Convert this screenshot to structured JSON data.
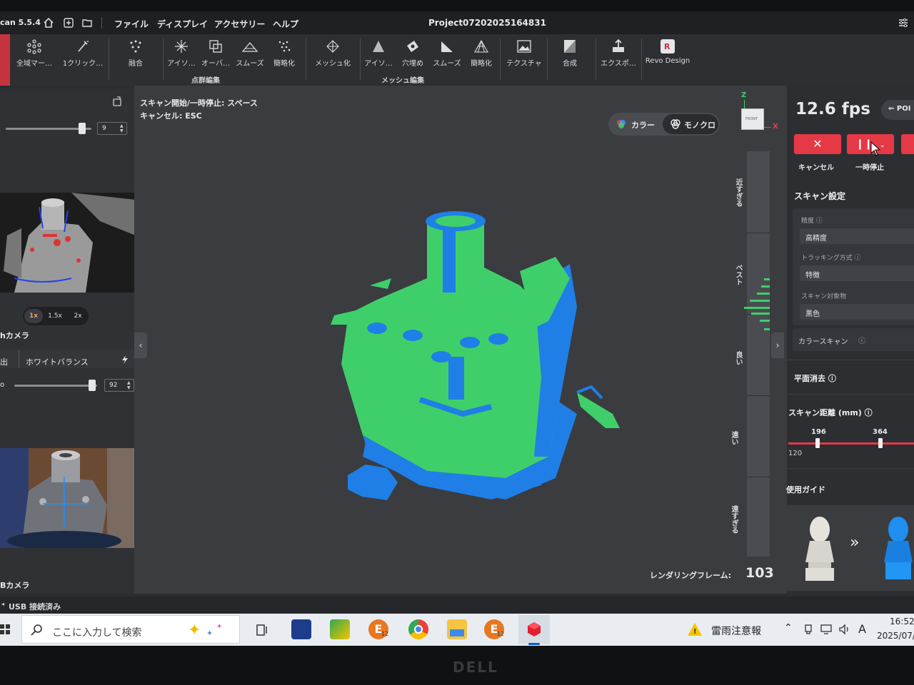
{
  "app": {
    "title_fragment": "can 5.5.4",
    "project": "Project07202025164831",
    "menu": [
      "ファイル",
      "ディスプレイ",
      "アクセサリー",
      "ヘルプ"
    ]
  },
  "ribbon": {
    "tools": [
      {
        "label": "全域マー…",
        "icon": "global-marker-icon"
      },
      {
        "label": "1クリック…",
        "icon": "one-click-icon"
      },
      {
        "label": "融合",
        "icon": "fuse-icon"
      },
      {
        "label": "アイソ…",
        "icon": "isolate-icon"
      },
      {
        "label": "オーバ…",
        "icon": "overlap-icon"
      },
      {
        "label": "スムーズ",
        "icon": "smooth-icon"
      },
      {
        "label": "簡略化",
        "icon": "simplify-icon"
      },
      {
        "label": "メッシュ化",
        "icon": "mesh-icon"
      },
      {
        "label": "アイソ…",
        "icon": "isolate-mesh-icon"
      },
      {
        "label": "穴埋め",
        "icon": "fill-hole-icon"
      },
      {
        "label": "スムーズ",
        "icon": "smooth-mesh-icon"
      },
      {
        "label": "簡略化",
        "icon": "simplify-mesh-icon"
      },
      {
        "label": "テクスチャ",
        "icon": "texture-icon"
      },
      {
        "label": "合成",
        "icon": "merge-icon"
      },
      {
        "label": "エクスポ…",
        "icon": "export-icon"
      },
      {
        "label": "Revo Design",
        "icon": "revo-design-icon"
      }
    ],
    "groups": {
      "point_cloud": "点群編集",
      "mesh": "メッシュ編集"
    }
  },
  "left": {
    "slider1_value": "9",
    "zoom_options": [
      "1x",
      "1.5x",
      "2x"
    ],
    "zoom_selected": "1x",
    "camera1_label": "hカメラ",
    "tab_exposure": "出",
    "tab_white_balance": "ホワイトバランス",
    "slider2_value": "92",
    "slider2_prefix": "o",
    "camera2_label": "Bカメラ"
  },
  "viewport": {
    "hint_scan": "スキャン開始/一時停止: スペース",
    "hint_cancel": "キャンセル: ESC",
    "mode_color": "カラー",
    "mode_mono": "モノクロ",
    "axis_z": "Z",
    "axis_x": "X",
    "cube_face": "FRONT",
    "distance_labels": [
      "近すぎる",
      "ベスト",
      "良い",
      "遠い",
      "遠すぎる"
    ],
    "render_label": "レンダリングフレーム:",
    "render_value": "103"
  },
  "right": {
    "fps": "12.6 fps",
    "po_label": "POI",
    "cancel_label": "キャンセル",
    "pause_label": "一時停止",
    "scan_settings": "スキャン設定",
    "precision_label": "精度",
    "precision_value": "高精度",
    "tracking_label": "トラッキング方式",
    "tracking_value": "特徴",
    "target_label": "スキャン対象物",
    "target_value": "黒色",
    "color_scan": "カラースキャン",
    "plane_removal": "平面消去",
    "scan_distance": "スキャン距離 (mm)",
    "dist_low": "196",
    "dist_high": "364",
    "dist_min": "120",
    "usage_guide": "使用ガイド",
    "guide_arrow": "»"
  },
  "status": {
    "usb": "USB 接続済み"
  },
  "taskbar": {
    "search_placeholder": "ここに入力して検索",
    "weather": "雷雨注意報",
    "ime": "A",
    "time": "16:52",
    "date": "2025/07/",
    "badge": "12"
  },
  "monitor": {
    "brand": "DELL"
  },
  "colors": {
    "accent": "#e63946",
    "scan_green": "#3fcf6a",
    "scan_blue": "#1f7fe6"
  }
}
